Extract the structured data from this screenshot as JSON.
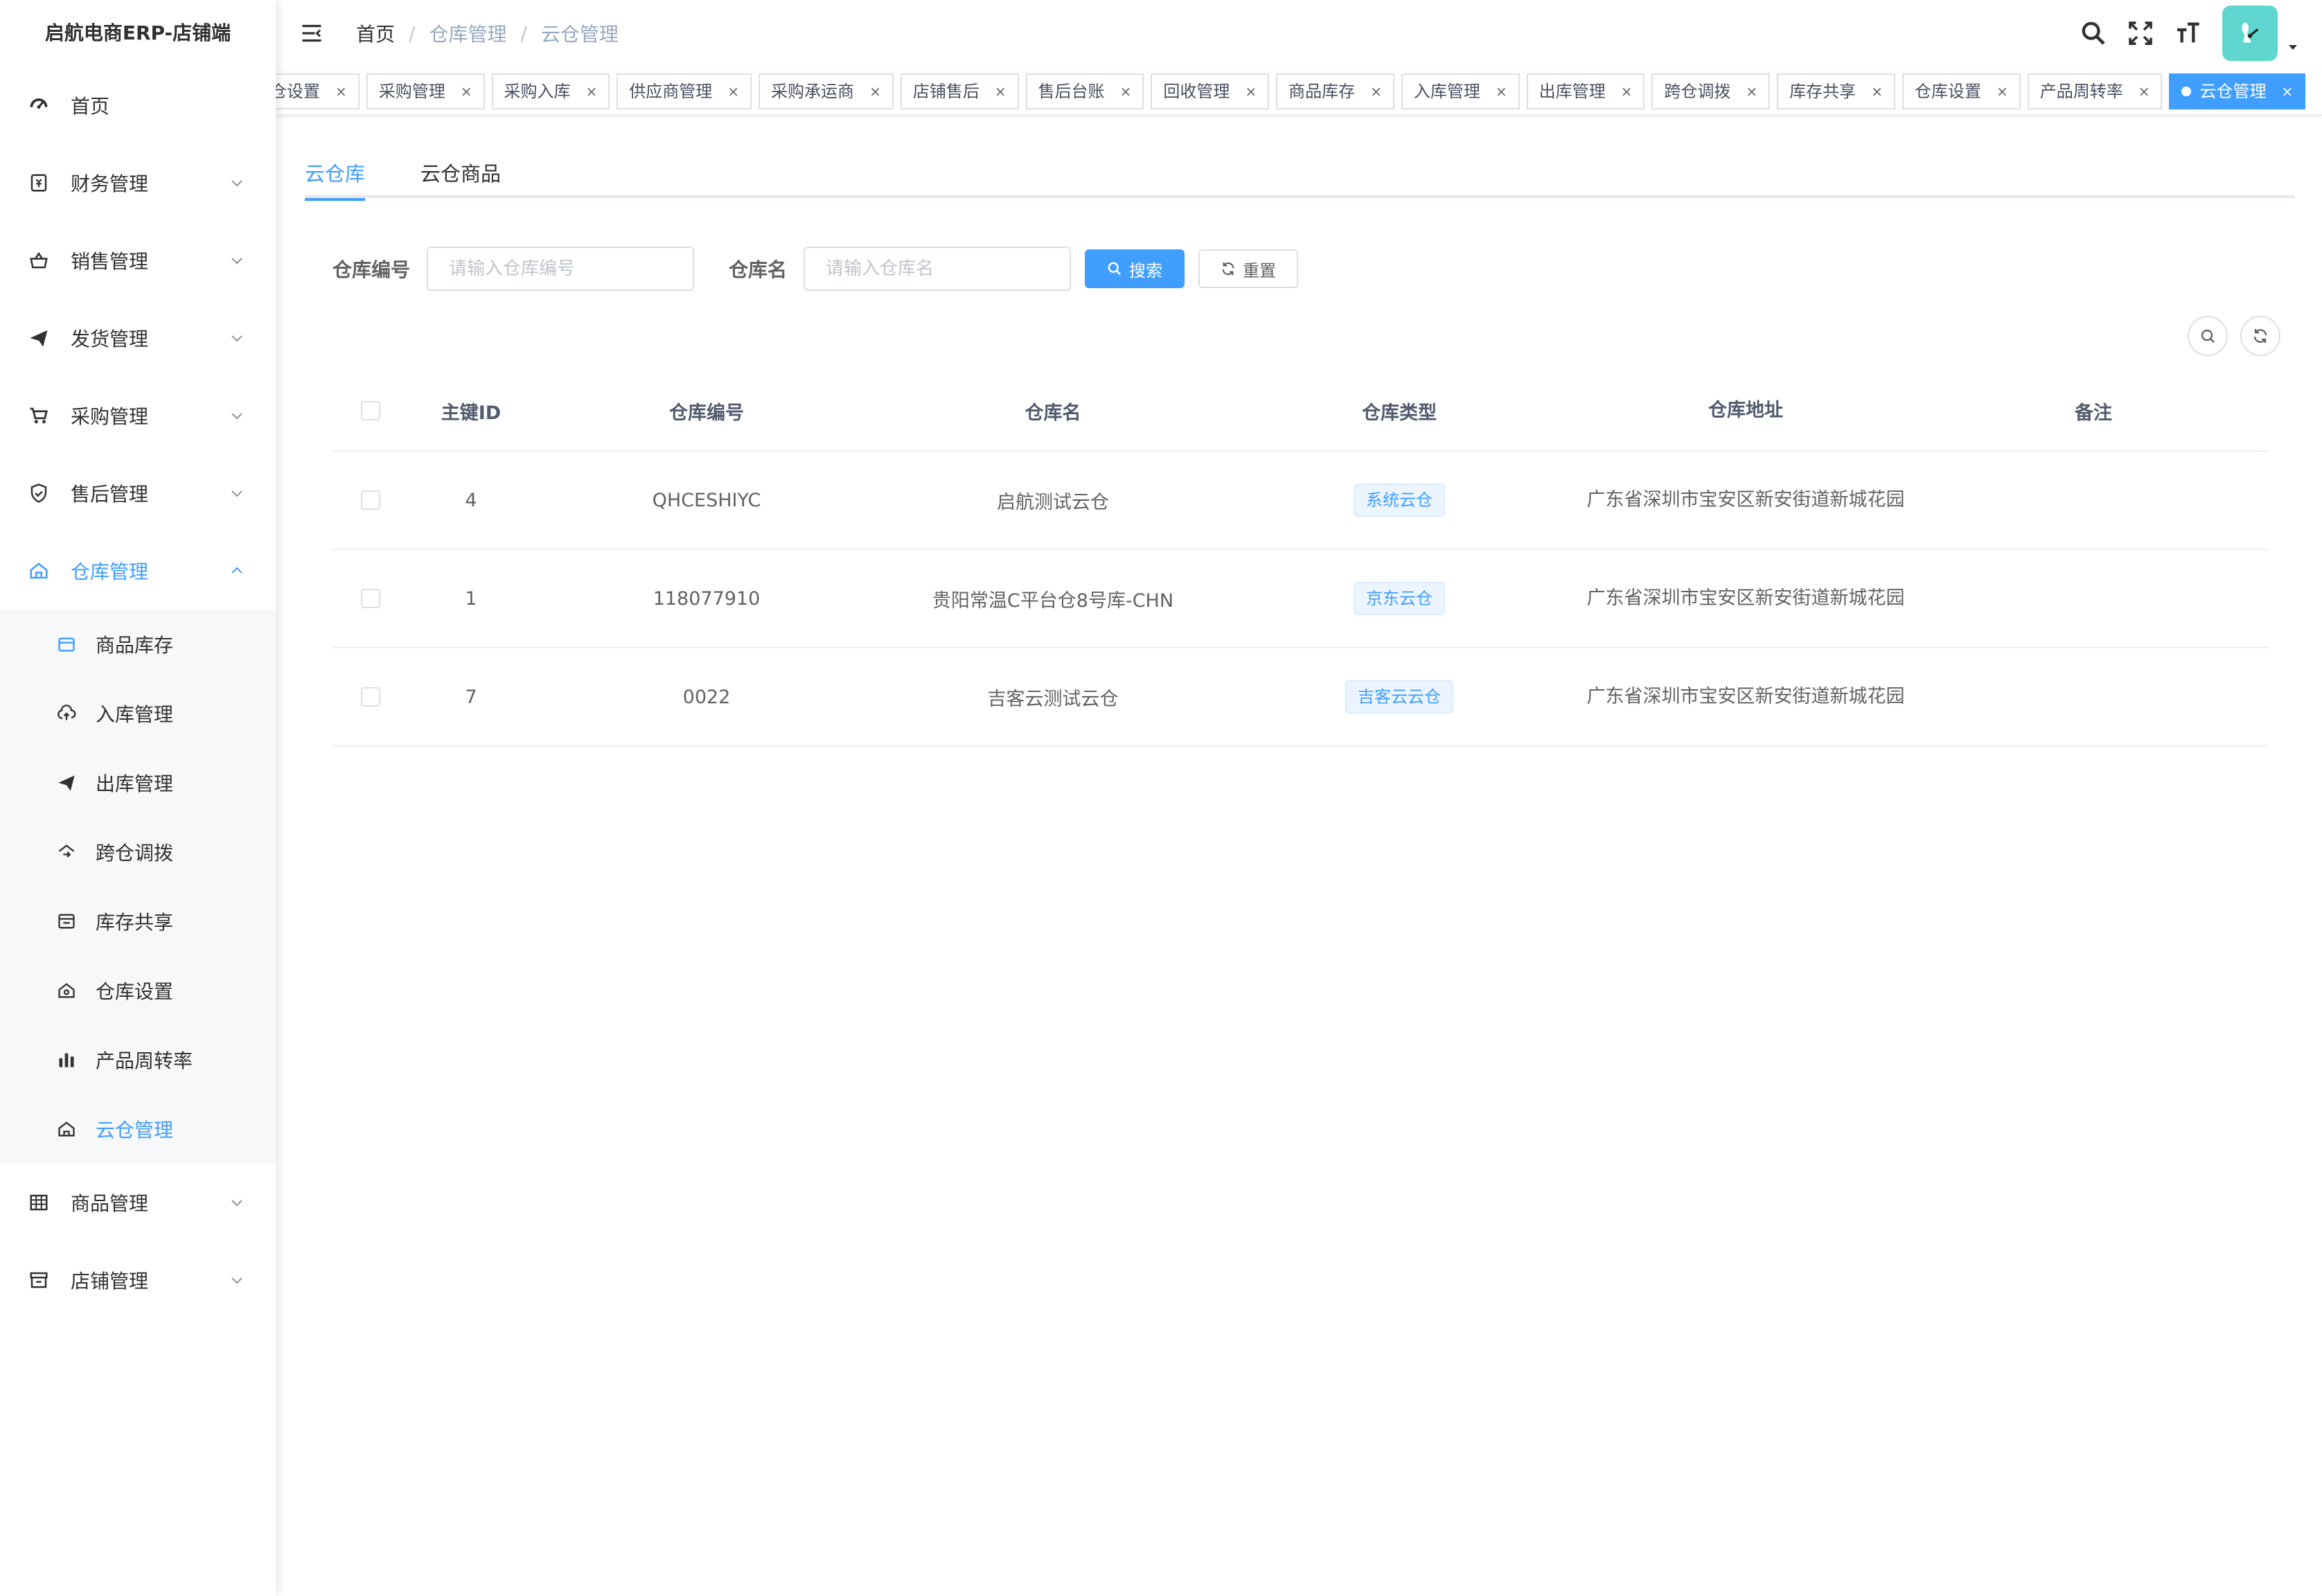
{
  "app": {
    "title": "启航电商ERP-店铺端"
  },
  "sidebar": {
    "items": [
      {
        "label": "首页",
        "icon": "dashboard-icon"
      },
      {
        "label": "财务管理",
        "icon": "finance-icon"
      },
      {
        "label": "销售管理",
        "icon": "sales-icon"
      },
      {
        "label": "发货管理",
        "icon": "paper-plane-icon"
      },
      {
        "label": "采购管理",
        "icon": "cart-icon"
      },
      {
        "label": "售后管理",
        "icon": "shield-icon"
      },
      {
        "label": "仓库管理",
        "icon": "warehouse-icon"
      },
      {
        "label": "商品管理",
        "icon": "table-icon"
      },
      {
        "label": "店铺管理",
        "icon": "store-icon"
      }
    ],
    "warehouse_sub": [
      {
        "label": "商品库存",
        "icon": "inventory-icon"
      },
      {
        "label": "入库管理",
        "icon": "cloud-upload-icon"
      },
      {
        "label": "出库管理",
        "icon": "paper-plane-icon"
      },
      {
        "label": "跨仓调拨",
        "icon": "transfer-icon"
      },
      {
        "label": "库存共享",
        "icon": "share-icon"
      },
      {
        "label": "仓库设置",
        "icon": "house-settings-icon"
      },
      {
        "label": "产品周转率",
        "icon": "bar-chart-icon"
      },
      {
        "label": "云仓管理",
        "icon": "cloud-warehouse-icon"
      }
    ]
  },
  "header": {
    "breadcrumb": [
      "首页",
      "仓库管理",
      "云仓管理"
    ],
    "separator": "/"
  },
  "tags": [
    {
      "label": "仓设置"
    },
    {
      "label": "采购管理"
    },
    {
      "label": "采购入库"
    },
    {
      "label": "供应商管理"
    },
    {
      "label": "采购承运商"
    },
    {
      "label": "店铺售后"
    },
    {
      "label": "售后台账"
    },
    {
      "label": "回收管理"
    },
    {
      "label": "商品库存"
    },
    {
      "label": "入库管理"
    },
    {
      "label": "出库管理"
    },
    {
      "label": "跨仓调拨"
    },
    {
      "label": "库存共享"
    },
    {
      "label": "仓库设置"
    },
    {
      "label": "产品周转率"
    },
    {
      "label": "云仓管理"
    }
  ],
  "tag_close": "×",
  "tabs": [
    "云仓库",
    "云仓商品"
  ],
  "search": {
    "code_label": "仓库编号",
    "code_placeholder": "请输入仓库编号",
    "name_label": "仓库名",
    "name_placeholder": "请输入仓库名",
    "search_button": "搜索",
    "reset_button": "重置"
  },
  "table": {
    "columns": [
      "主键ID",
      "仓库编号",
      "仓库名",
      "仓库类型",
      "仓库地址",
      "备注"
    ],
    "rows": [
      {
        "id": "4",
        "code": "QHCESHIYC",
        "name": "启航测试云仓",
        "type": "系统云仓",
        "address": "广东省深圳市宝安区新安街道新城花园",
        "note": ""
      },
      {
        "id": "1",
        "code": "118077910",
        "name": "贵阳常温C平台仓8号库-CHN",
        "type": "京东云仓",
        "address": "广东省深圳市宝安区新安街道新城花园",
        "note": ""
      },
      {
        "id": "7",
        "code": "0022",
        "name": "吉客云测试云仓",
        "type": "吉客云云仓",
        "address": "广东省深圳市宝安区新安街道新城花园",
        "note": ""
      }
    ]
  },
  "colors": {
    "accent": "#409eff",
    "avatar_bg": "#5fd6cf"
  }
}
